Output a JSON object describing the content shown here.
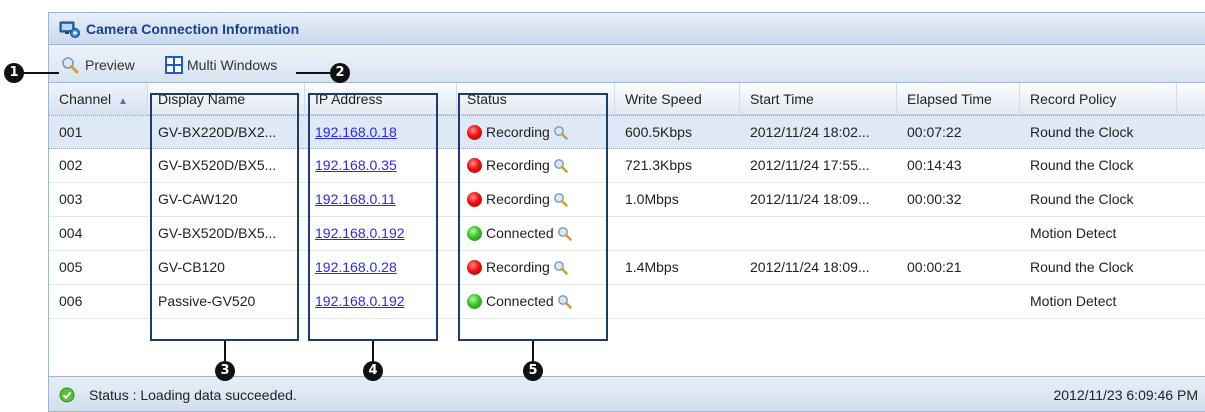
{
  "window": {
    "title": "Camera Connection Information"
  },
  "toolbar": {
    "preview_label": "Preview",
    "multi_label": "Multi Windows"
  },
  "columns": [
    "Channel",
    "Display Name",
    "IP Address",
    "Status",
    "Write Speed",
    "Start Time",
    "Elapsed Time",
    "Record Policy"
  ],
  "rows": [
    {
      "channel": "001",
      "name": "GV-BX220D/BX2...",
      "ip": "192.168.0.18",
      "status": "Recording",
      "speed": "600.5Kbps",
      "start": "2012/11/24 18:02...",
      "elapsed": "00:07:22",
      "policy": "Round the Clock"
    },
    {
      "channel": "002",
      "name": "GV-BX520D/BX5...",
      "ip": "192.168.0.35",
      "status": "Recording",
      "speed": "721.3Kbps",
      "start": "2012/11/24 17:55...",
      "elapsed": "00:14:43",
      "policy": "Round the Clock"
    },
    {
      "channel": "003",
      "name": "GV-CAW120",
      "ip": "192.168.0.11",
      "status": "Recording",
      "speed": "1.0Mbps",
      "start": "2012/11/24 18:09...",
      "elapsed": "00:00:32",
      "policy": "Round the Clock"
    },
    {
      "channel": "004",
      "name": "GV-BX520D/BX5...",
      "ip": "192.168.0.192",
      "status": "Connected",
      "speed": "",
      "start": "",
      "elapsed": "",
      "policy": "Motion Detect"
    },
    {
      "channel": "005",
      "name": "GV-CB120",
      "ip": "192.168.0.28",
      "status": "Recording",
      "speed": "1.4Mbps",
      "start": "2012/11/24 18:09...",
      "elapsed": "00:00:21",
      "policy": "Round the Clock"
    },
    {
      "channel": "006",
      "name": "Passive-GV520",
      "ip": "192.168.0.192",
      "status": "Connected",
      "speed": "",
      "start": "",
      "elapsed": "",
      "policy": "Motion Detect"
    }
  ],
  "statusbar": {
    "text": "Status : Loading data succeeded.",
    "time": "2012/11/23 6:09:46 PM"
  },
  "callouts": [
    "1",
    "2",
    "3",
    "4",
    "5"
  ],
  "colors": {
    "recording": "#e11111",
    "connected": "#3ac12b",
    "title": "#15428b",
    "annotation": "#1f3b6d"
  }
}
